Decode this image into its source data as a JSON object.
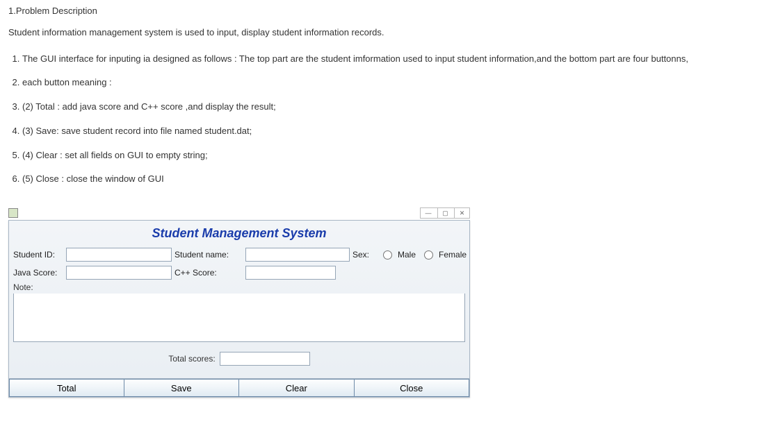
{
  "section_heading": "1.Problem Description",
  "intro": "Student information management system is used to input, display student information records.",
  "list": [
    "The GUI interface for inputing ia designed as follows : The top part are the student imformation used to input student information,and the bottom part are four buttonns,",
    "each button meaning :",
    "(2)  Total : add java score and C++ score ,and display the result;",
    "(3)  Save:  save student record into file named student.dat;",
    "(4)  Clear : set all fields on GUI to empty string;",
    "(5)  Close : close the window of GUI"
  ],
  "window": {
    "controls": {
      "min": "—",
      "max": "▢",
      "close": "✕"
    },
    "title": "Student Management System",
    "labels": {
      "student_id": "Student ID:",
      "student_name": "Student name:",
      "sex": "Sex:",
      "male": "Male",
      "female": "Female",
      "java_score": "Java Score:",
      "cpp_score": "C++ Score:",
      "note": "Note:",
      "total_scores": "Total scores:"
    },
    "values": {
      "student_id": "",
      "student_name": "",
      "java_score": "",
      "cpp_score": "",
      "note": "",
      "total_scores": ""
    },
    "buttons": {
      "total": "Total",
      "save": "Save",
      "clear": "Clear",
      "close": "Close"
    }
  }
}
